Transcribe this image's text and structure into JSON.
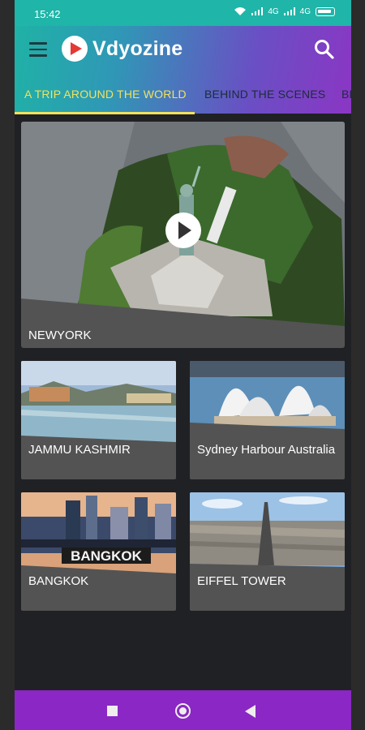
{
  "status_bar": {
    "time": "15:42",
    "net": "4G",
    "net2": "4G"
  },
  "app": {
    "title": "Vdyozine"
  },
  "tabs": [
    {
      "label": "A TRIP AROUND THE WORLD",
      "active": true
    },
    {
      "label": "BEHIND THE SCENES",
      "active": false
    },
    {
      "label": "BE",
      "active": false
    }
  ],
  "featured": {
    "label": "NEWYORK"
  },
  "cards": [
    {
      "label": "JAMMU KASHMIR"
    },
    {
      "label": "Sydney Harbour  Australia"
    },
    {
      "label": "BANGKOK"
    },
    {
      "label": "EIFFEL TOWER"
    }
  ],
  "thumb_texts": {
    "bangkok_sign": "BANGKOK"
  },
  "colors": {
    "accent": "#f2e25c",
    "card_bg": "#535353",
    "nav_bar": "#8b27c4"
  }
}
